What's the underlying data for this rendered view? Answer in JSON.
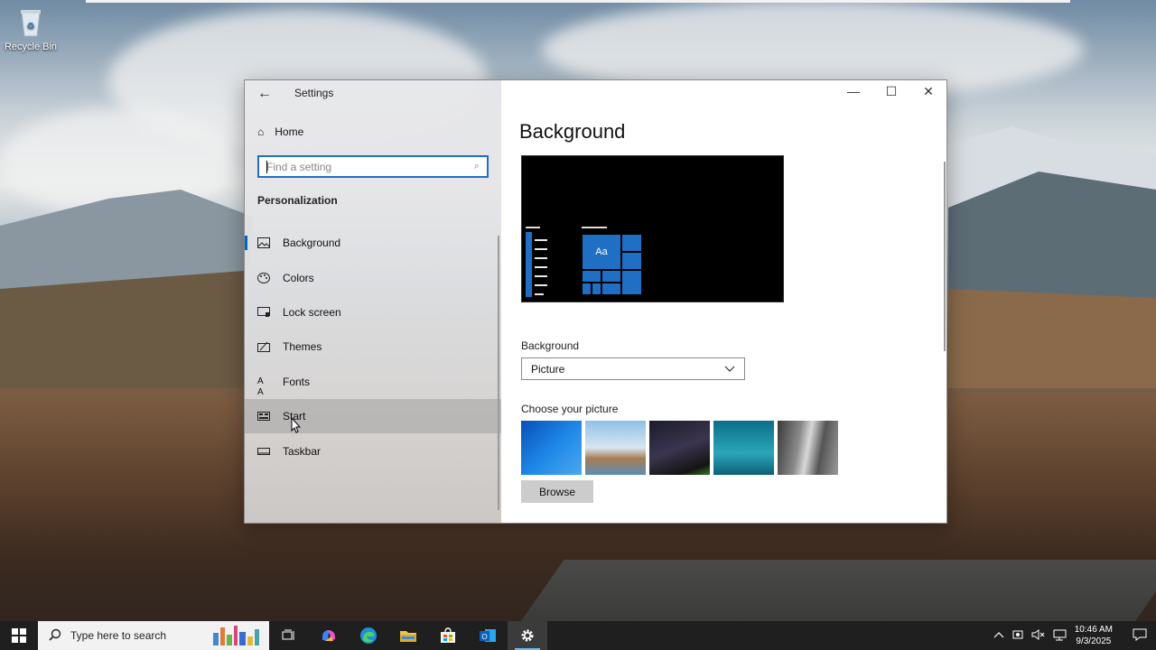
{
  "desktop": {
    "recycle_bin_label": "Recycle Bin"
  },
  "window": {
    "title": "Settings",
    "controls": {
      "minimize": "—",
      "maximize": "☐",
      "close": "✕"
    }
  },
  "sidebar": {
    "home_label": "Home",
    "search_placeholder": "Find a setting",
    "section_title": "Personalization",
    "items": [
      {
        "label": "Background",
        "icon": "image-icon"
      },
      {
        "label": "Colors",
        "icon": "palette-icon"
      },
      {
        "label": "Lock screen",
        "icon": "lock-screen-icon"
      },
      {
        "label": "Themes",
        "icon": "themes-icon"
      },
      {
        "label": "Fonts",
        "icon": "fonts-icon"
      },
      {
        "label": "Start",
        "icon": "start-icon"
      },
      {
        "label": "Taskbar",
        "icon": "taskbar-icon"
      }
    ],
    "fonts_glyph": "A A"
  },
  "main": {
    "page_title": "Background",
    "preview_tile_text": "Aa",
    "background_label": "Background",
    "background_value": "Picture",
    "choose_label": "Choose your picture",
    "browse_label": "Browse"
  },
  "taskbar": {
    "search_placeholder": "Type here to search",
    "time": "10:46 AM",
    "date": "9/3/2025"
  },
  "colors": {
    "accent": "#0067c0",
    "tile_blue": "#1f6fc4"
  }
}
